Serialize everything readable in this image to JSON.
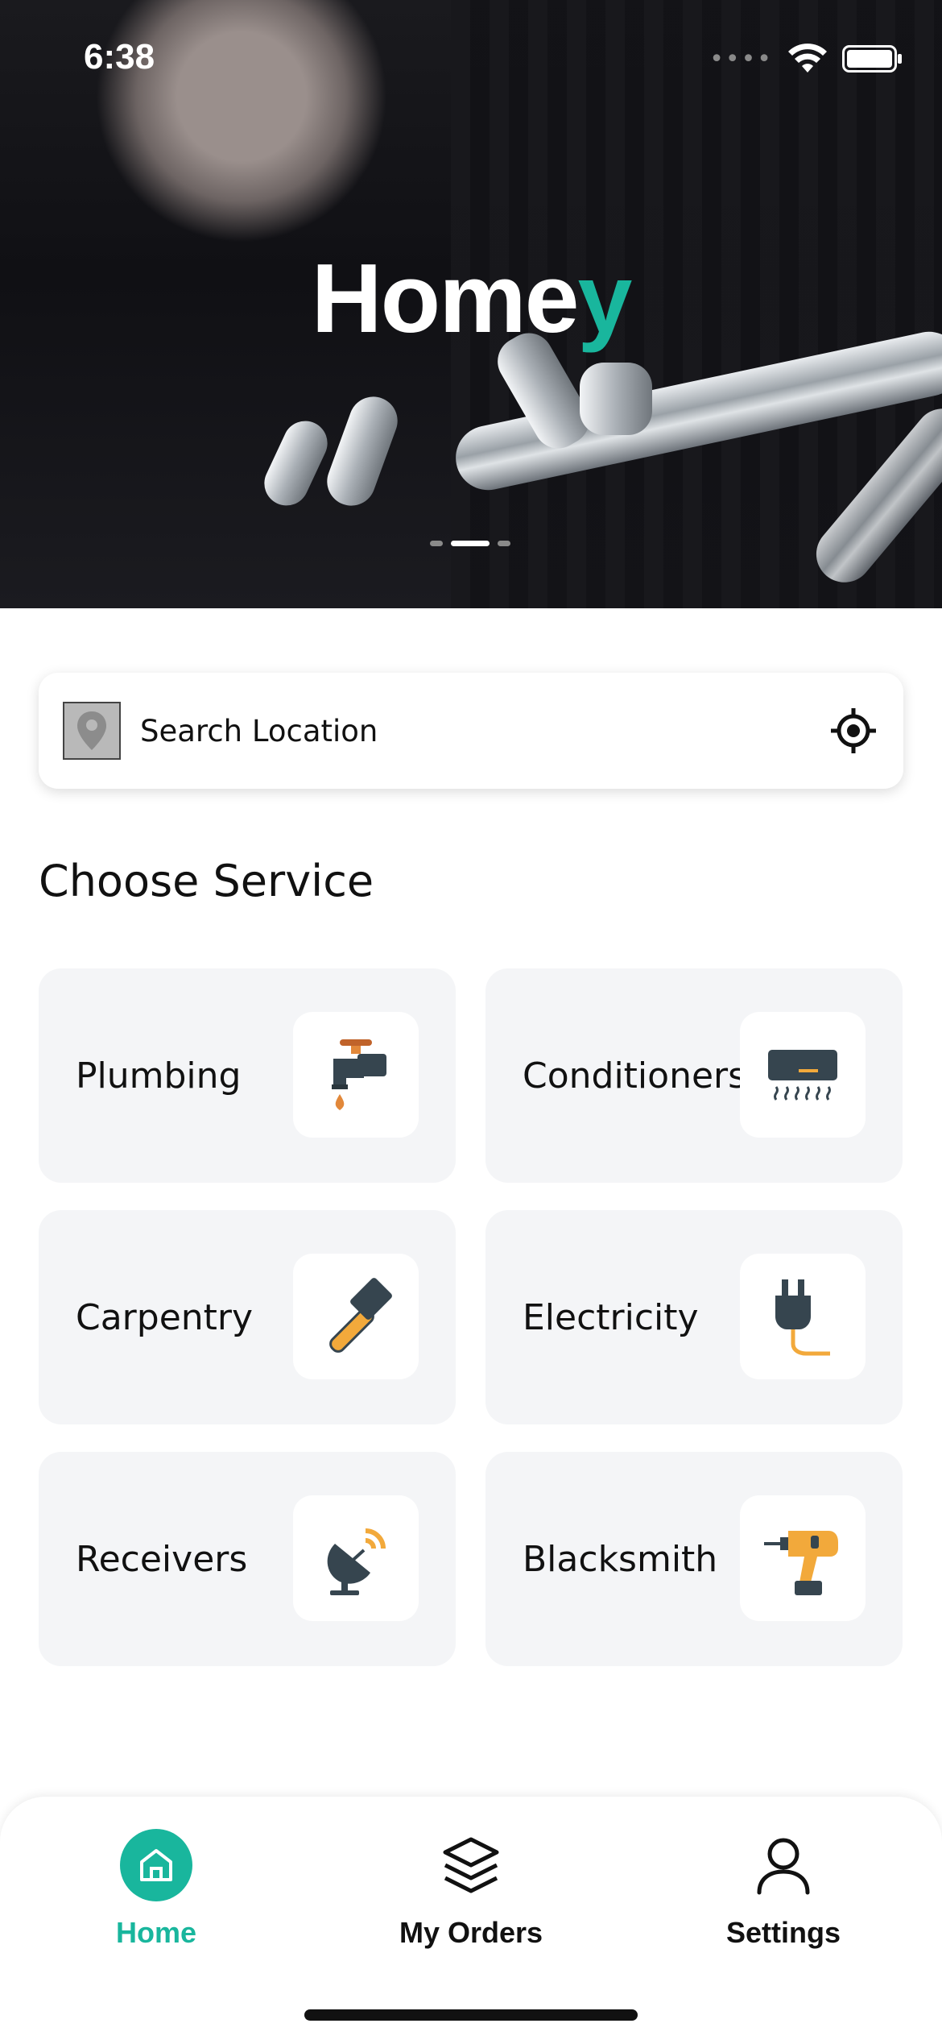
{
  "status_bar": {
    "time": "6:38"
  },
  "hero": {
    "brand_main": "Home",
    "brand_accent": "y",
    "slides": 3,
    "active_slide": 2
  },
  "search": {
    "placeholder": "Search Location"
  },
  "section_title": "Choose Service",
  "services": [
    {
      "label": "Plumbing",
      "icon": "faucet-icon"
    },
    {
      "label": "Conditioners",
      "icon": "air-conditioner-icon"
    },
    {
      "label": "Carpentry",
      "icon": "hammer-icon"
    },
    {
      "label": "Electricity",
      "icon": "plug-icon"
    },
    {
      "label": "Receivers",
      "icon": "satellite-dish-icon"
    },
    {
      "label": "Blacksmith",
      "icon": "drill-icon"
    }
  ],
  "nav": [
    {
      "label": "Home",
      "icon": "home-icon",
      "active": true
    },
    {
      "label": "My Orders",
      "icon": "layers-icon",
      "active": false
    },
    {
      "label": "Settings",
      "icon": "user-icon",
      "active": false
    }
  ],
  "colors": {
    "accent": "#19b69d",
    "card_bg": "#f4f5f7"
  }
}
